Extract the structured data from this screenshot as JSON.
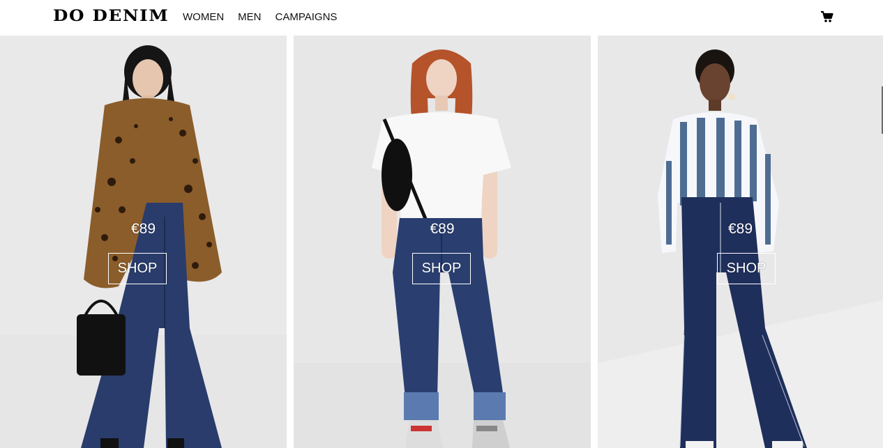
{
  "brand": {
    "logo_text": "DO DENIM"
  },
  "nav": {
    "items": [
      {
        "label": "WOMEN"
      },
      {
        "label": "MEN"
      },
      {
        "label": "CAMPAIGNS"
      }
    ]
  },
  "header": {
    "cart_icon": "shopping-cart-icon"
  },
  "products": [
    {
      "price": "€89",
      "shop_label": "SHOP",
      "image": "model-leopard-coat-flare-jeans"
    },
    {
      "price": "€89",
      "shop_label": "SHOP",
      "image": "model-white-tee-cuffed-jeans"
    },
    {
      "price": "€89",
      "shop_label": "SHOP",
      "image": "model-striped-shirt-dark-jeans"
    }
  ],
  "colors": {
    "background": "#ffffff",
    "photo_backdrop": "#e9e9ea",
    "denim": "#283d6e",
    "overlay_text": "#ffffff"
  }
}
